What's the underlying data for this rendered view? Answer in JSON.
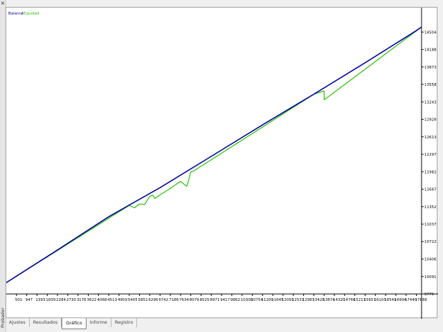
{
  "side_panel": {
    "label": "Probador",
    "close_glyph": "×"
  },
  "tabs": [
    {
      "label": "Ajustes",
      "active": false
    },
    {
      "label": "Resultados",
      "active": false
    },
    {
      "label": "Gráfico",
      "active": true
    },
    {
      "label": "Informe",
      "active": false
    },
    {
      "label": "Registro",
      "active": false
    }
  ],
  "chart_data": {
    "type": "line",
    "legend": [
      "Balance",
      "Equidad"
    ],
    "legend_placement": "top-left",
    "colors": {
      "balance": "#0000a0",
      "equity": "#22c000"
    },
    "x_ticks": [
      "501",
      "947",
      "1393",
      "1839",
      "2284",
      "2730",
      "3176",
      "3622",
      "4068",
      "4513",
      "4959",
      "5405",
      "5851",
      "6296",
      "6742",
      "7188",
      "7634",
      "8079",
      "8525",
      "8971",
      "9417",
      "9862",
      "10308",
      "10754",
      "11200",
      "11645",
      "12091",
      "12537",
      "12983",
      "13428",
      "13874",
      "14320",
      "14766",
      "15211",
      "15657",
      "16103",
      "16549",
      "16994",
      "17440",
      "17886"
    ],
    "y_ticks": [
      14504,
      14188,
      13873,
      13558,
      13243,
      12928,
      12613,
      12297,
      11982,
      11667,
      11352,
      11037,
      10722,
      10406,
      10091,
      9776
    ],
    "xlim": [
      56,
      18110
    ],
    "ylim": [
      9776,
      14595
    ],
    "grid": false,
    "series": [
      {
        "name": "Balance",
        "x": [
          56,
          2284,
          4513,
          6742,
          8971,
          11200,
          13428,
          15657,
          17886,
          18110
        ],
        "y": [
          9980,
          10570,
          11170,
          11695,
          12260,
          12830,
          13382,
          13950,
          14530,
          14595
        ]
      },
      {
        "name": "Equidad",
        "x": [
          56,
          5405,
          5630,
          5851,
          6070,
          6296,
          6420,
          6520,
          6742,
          7188,
          7634,
          7780,
          7900,
          8000,
          8079,
          8200,
          13428,
          13874,
          13880,
          18110
        ],
        "y": [
          9980,
          11375,
          11330,
          11400,
          11390,
          11540,
          11560,
          11500,
          11565,
          11680,
          11810,
          11760,
          11720,
          11850,
          11980,
          11995,
          13382,
          13440,
          13280,
          14595
        ]
      }
    ]
  }
}
